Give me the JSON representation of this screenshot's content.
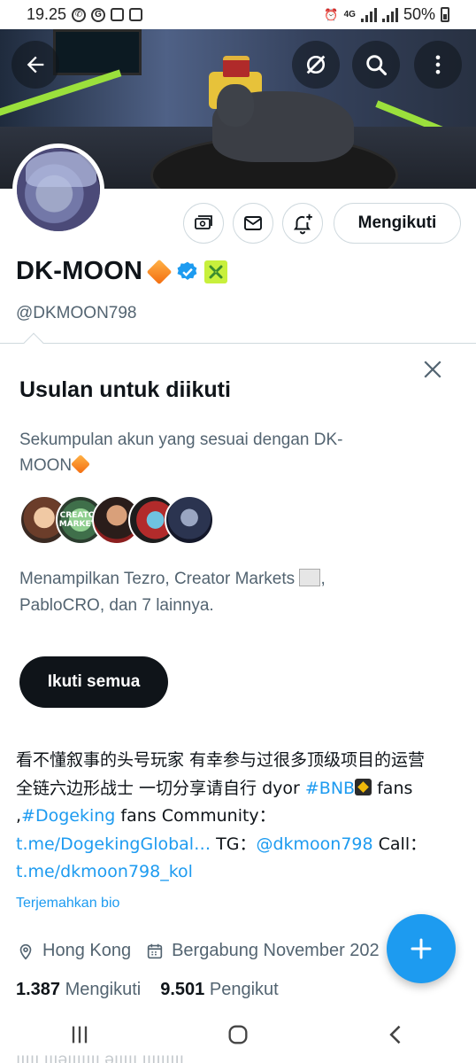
{
  "status_bar": {
    "time": "19.25",
    "battery": "50%",
    "network": "4G"
  },
  "header": {
    "back_icon": "arrow-left-icon",
    "actions": [
      "grok-icon",
      "search-icon",
      "more-vertical-icon"
    ]
  },
  "profile": {
    "display_name": "DK-MOON",
    "handle": "@DKMOON798",
    "follow_state_label": "Mengikuti",
    "verified": true,
    "action_icons": [
      "subscribe-icon",
      "message-icon",
      "notification-bell-icon"
    ]
  },
  "suggestions": {
    "title": "Usulan untuk diikuti",
    "description": "Sekumpulan akun yang sesuai dengan DK-MOON",
    "names_text": "Menampilkan Tezro, Creator Markets",
    "names_text_2": ", PabloCRO, dan 7 lainnya.",
    "follow_all_label": "Ikuti semua",
    "avatar_count": 5,
    "creator_avatar_text": "CREATOR MARKETS"
  },
  "bio": {
    "line1": "看不懂叙事的头号玩家 有幸参与过很多顶级项目的运营 全链六边形战士  一切分享请自行 dyor ",
    "hashtag_bnb": "#BNB",
    "fans1": " fans ,",
    "hashtag_dogeking": "#Dogeking",
    "fans2": " fans Community：",
    "link1": "t.me/DogekingGlobal…",
    "tg_label": " TG：",
    "tg_handle": "@dkmoon798",
    "call_label": " Call：",
    "link2": "t.me/dkmoon798_kol",
    "translate_label": "Terjemahkan bio"
  },
  "meta": {
    "location": "Hong Kong",
    "joined": "Bergabung November 202"
  },
  "stats": {
    "following_count": "1.387",
    "following_label": "Mengikuti",
    "followers_count": "9.501",
    "followers_label": "Pengikut"
  },
  "nav_ghost_text": "ııııı ıııəııııııı  əııııı ııııııııı",
  "colors": {
    "accent": "#1d9bf0",
    "text_primary": "#0f1419",
    "text_secondary": "#536471",
    "border": "#cfd9de"
  }
}
